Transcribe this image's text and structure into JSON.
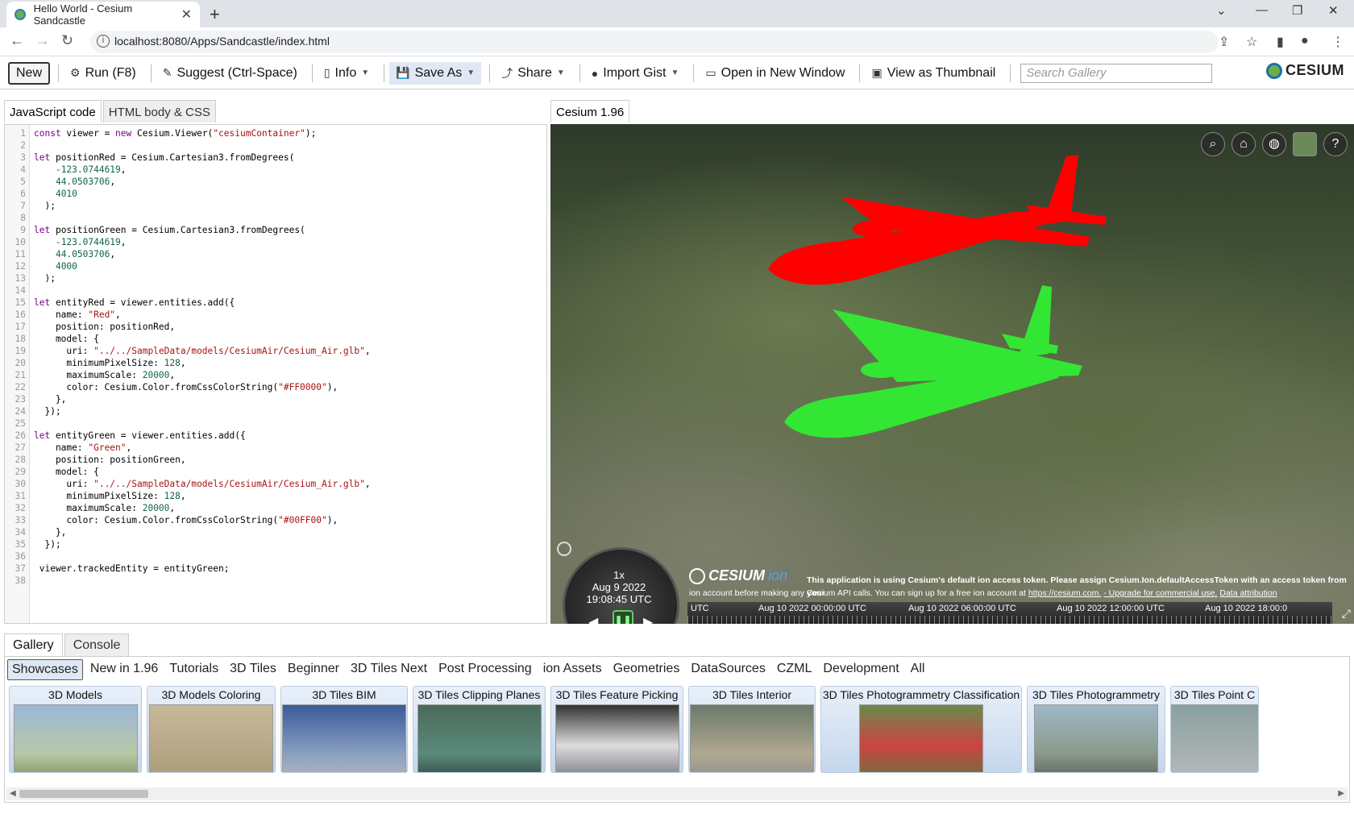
{
  "browser": {
    "tab_title": "Hello World - Cesium Sandcastle",
    "url": "localhost:8080/Apps/Sandcastle/index.html"
  },
  "toolbar": {
    "new": "New",
    "run": "Run (F8)",
    "suggest": "Suggest (Ctrl-Space)",
    "info": "Info",
    "save_as": "Save As",
    "share": "Share",
    "import_gist": "Import Gist",
    "open_new_window": "Open in New Window",
    "view_thumbnail": "View as Thumbnail",
    "search_placeholder": "Search Gallery",
    "logo": "CESIUM"
  },
  "editor": {
    "tabs": [
      "JavaScript code",
      "HTML body & CSS"
    ]
  },
  "code_lines": [
    "const viewer = new Cesium.Viewer(\"cesiumContainer\");",
    "",
    "let positionRed = Cesium.Cartesian3.fromDegrees(",
    "    -123.0744619,",
    "    44.0503706,",
    "    4010",
    "  );",
    "",
    "let positionGreen = Cesium.Cartesian3.fromDegrees(",
    "    -123.0744619,",
    "    44.0503706,",
    "    4000",
    "  );",
    "",
    "let entityRed = viewer.entities.add({",
    "    name: \"Red\",",
    "    position: positionRed,",
    "    model: {",
    "      uri: \"../../SampleData/models/CesiumAir/Cesium_Air.glb\",",
    "      minimumPixelSize: 128,",
    "      maximumScale: 20000,",
    "      color: Cesium.Color.fromCssColorString(\"#FF0000\"),",
    "    },",
    "  });",
    "",
    "let entityGreen = viewer.entities.add({",
    "    name: \"Green\",",
    "    position: positionGreen,",
    "    model: {",
    "      uri: \"../../SampleData/models/CesiumAir/Cesium_Air.glb\",",
    "      minimumPixelSize: 128,",
    "      maximumScale: 20000,",
    "      color: Cesium.Color.fromCssColorString(\"#00FF00\"),",
    "    },",
    "  });",
    "",
    " viewer.trackedEntity = entityGreen;",
    ""
  ],
  "viewer": {
    "tab": "Cesium 1.96",
    "anim_speed": "1x",
    "anim_date": "Aug 9 2022",
    "anim_time": "19:08:45 UTC",
    "ion_logo": "CESIUM",
    "ion_suffix": "ion",
    "credit_line1": "This application is using Cesium's default ion access token. Please assign Cesium.Ion.defaultAccessToken with an access token from your",
    "credit_line2": "ion account before making any Cesium API calls. You can sign up for a free ion account at",
    "credit_link1": "https://cesium.com.",
    "credit_link2": "- Upgrade for commercial use.",
    "credit_link3": "Data attribution",
    "timeline_labels": [
      "UTC",
      "Aug 10 2022 00:00:00 UTC",
      "Aug 10 2022 06:00:00 UTC",
      "Aug 10 2022 12:00:00 UTC",
      "Aug 10 2022 18:00:0"
    ],
    "plane_colors": {
      "red": "#ff0000",
      "green": "#33e633"
    }
  },
  "gallery": {
    "tabs": [
      "Gallery",
      "Console"
    ],
    "categories": [
      "Showcases",
      "New in 1.96",
      "Tutorials",
      "3D Tiles",
      "Beginner",
      "3D Tiles Next",
      "Post Processing",
      "ion Assets",
      "Geometries",
      "DataSources",
      "CZML",
      "Development",
      "All"
    ],
    "thumbnails": [
      "3D Models",
      "3D Models Coloring",
      "3D Tiles BIM",
      "3D Tiles Clipping Planes",
      "3D Tiles Feature Picking",
      "3D Tiles Interior",
      "3D Tiles Photogrammetry Classification",
      "3D Tiles Photogrammetry",
      "3D Tiles Point C"
    ]
  }
}
